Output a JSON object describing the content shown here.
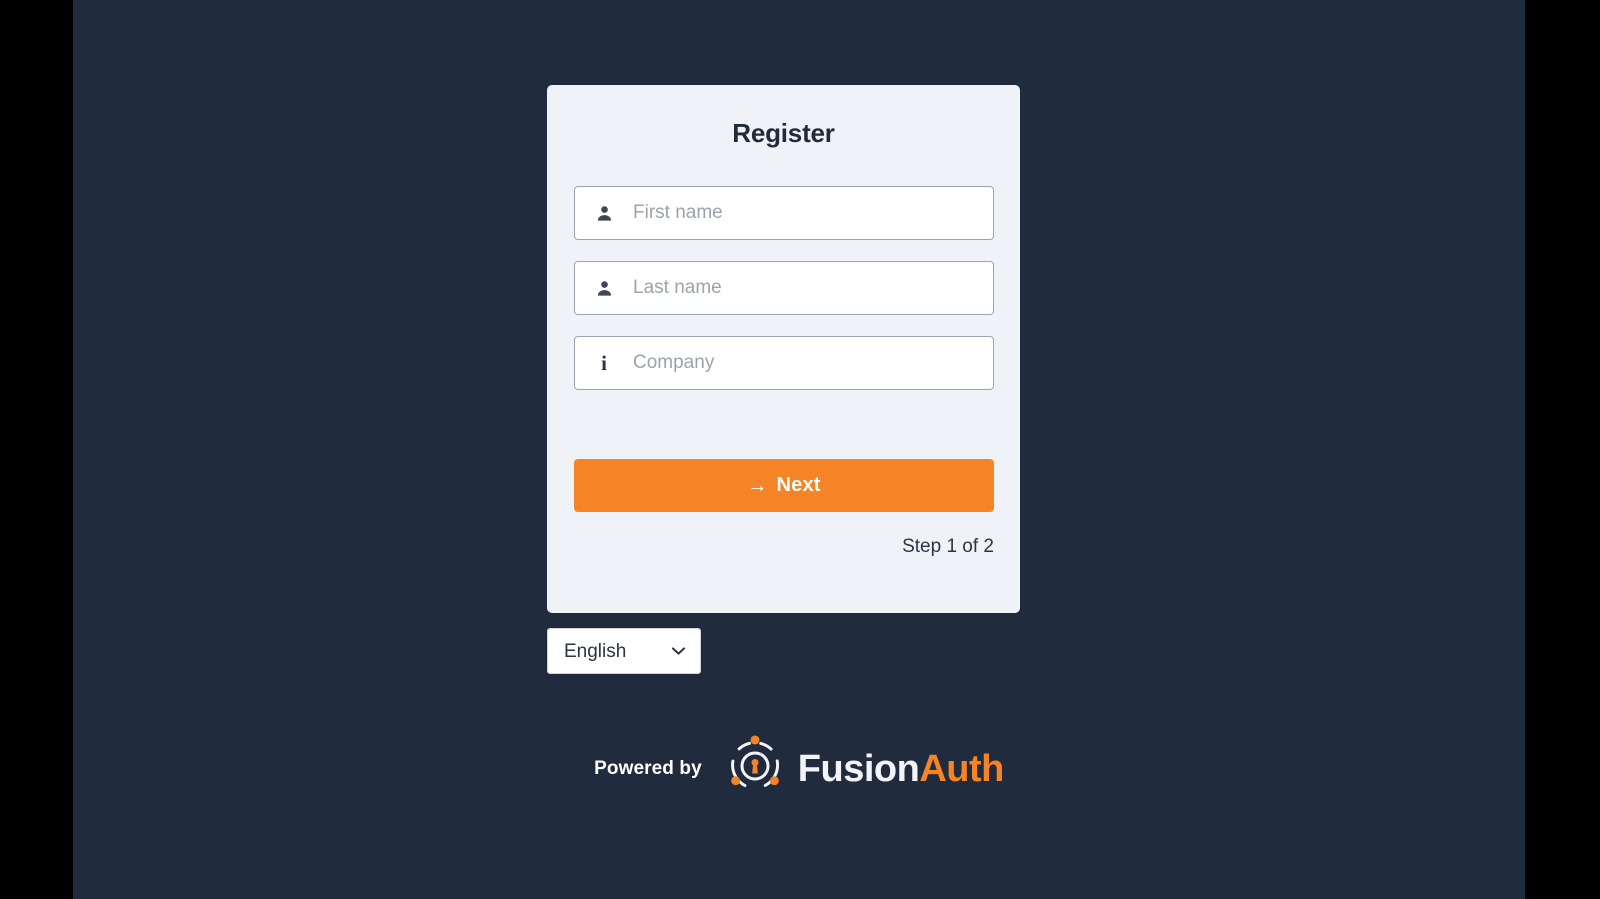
{
  "colors": {
    "page_background": "#202b3d",
    "card_background": "#eff2f7",
    "accent_orange": "#f58426",
    "text_dark": "#2c3545",
    "placeholder": "#9ba3ad",
    "letterbox": "#000000"
  },
  "card": {
    "title": "Register",
    "fields": [
      {
        "name": "first-name",
        "icon": "user-icon",
        "placeholder": "First name",
        "value": ""
      },
      {
        "name": "last-name",
        "icon": "user-icon",
        "placeholder": "Last name",
        "value": ""
      },
      {
        "name": "company",
        "icon": "info-icon",
        "placeholder": "Company",
        "value": ""
      }
    ],
    "submit": {
      "label": "Next",
      "icon": "arrow-right-icon",
      "glyph": "→"
    },
    "step_text": "Step 1 of 2"
  },
  "locale": {
    "selected": "English",
    "options": [
      "English"
    ],
    "chevron_icon": "chevron-down-icon"
  },
  "footer": {
    "powered_by": "Powered by",
    "logo_icon": "fusionauth-emblem-icon",
    "brand_first": "Fusion",
    "brand_second": "Auth"
  }
}
